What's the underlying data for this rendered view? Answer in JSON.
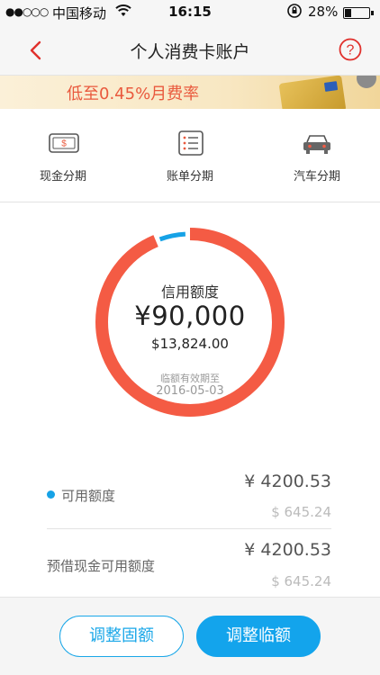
{
  "status_bar": {
    "signal": "●●○○○",
    "carrier": "中国移动",
    "time": "16:15",
    "battery": "28%",
    "battery_level": 0.28,
    "icons": [
      "signal-icon",
      "wifi-icon",
      "rotation-lock-icon",
      "battery-icon"
    ]
  },
  "nav": {
    "title": "个人消费卡账户",
    "back_icon": "chevron-left-icon",
    "help_icon": "question-circle-icon"
  },
  "banner": {
    "text": "低至0.45%月费率"
  },
  "services": [
    {
      "label": "现金分期",
      "icon": "cash-icon"
    },
    {
      "label": "账单分期",
      "icon": "bill-list-icon"
    },
    {
      "label": "汽车分期",
      "icon": "car-icon"
    }
  ],
  "credit": {
    "label": "信用额度",
    "amount": "¥90,000",
    "usd": "$13,824.00",
    "validity_label": "临额有效期至",
    "validity_date": "2016-05-03",
    "used_fraction": 0.047
  },
  "rows": [
    {
      "label": "可用额度",
      "cny": "¥ 4200.53",
      "usd": "$ 645.24"
    },
    {
      "label": "预借现金可用额度",
      "cny": "¥ 4200.53",
      "usd": "$ 645.24"
    }
  ],
  "buttons": {
    "fixed": "调整固额",
    "temp": "调整临额"
  },
  "colors": {
    "accent_red": "#f45b44",
    "accent_blue": "#16a2e6",
    "banner_text": "#e9593d"
  }
}
